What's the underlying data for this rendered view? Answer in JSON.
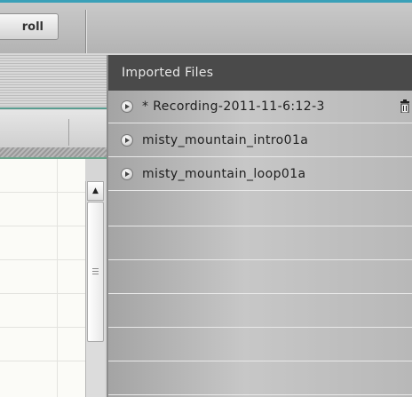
{
  "toolbar": {
    "roll_button_label": "roll"
  },
  "imported_files": {
    "title": "Imported Files",
    "files": [
      {
        "label": "* Recording-2011-11-6:12-3"
      },
      {
        "label": "misty_mountain_intro01a"
      },
      {
        "label": "misty_mountain_loop01a"
      }
    ]
  },
  "scrollbar": {
    "up_glyph": "▲"
  },
  "icons": {
    "play": "play-circle-icon",
    "delete": "trash-icon"
  },
  "colors": {
    "accent": "#3aa0b8",
    "panel_title_bg": "#4a4a4a"
  }
}
